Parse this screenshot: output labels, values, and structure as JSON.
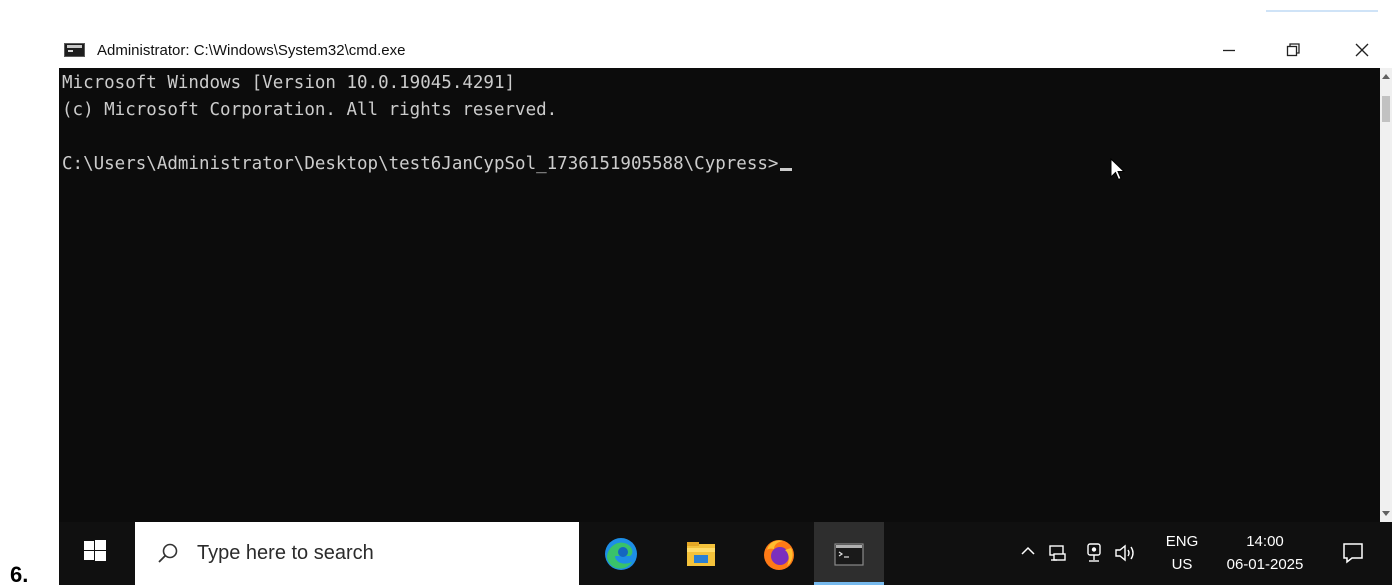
{
  "step_label": "6.",
  "window": {
    "title": "Administrator: C:\\Windows\\System32\\cmd.exe",
    "controls": {
      "minimize_icon": "minimize-icon",
      "maximize_icon": "restore-icon",
      "close_icon": "close-icon"
    }
  },
  "console": {
    "lines": [
      "Microsoft Windows [Version 10.0.19045.4291]",
      "(c) Microsoft Corporation. All rights reserved.",
      "",
      "C:\\Users\\Administrator\\Desktop\\test6JanCypSol_1736151905588\\Cypress>"
    ],
    "background": "#0c0c0c",
    "foreground": "#cccccc"
  },
  "taskbar": {
    "search_placeholder": "Type here to search",
    "apps": [
      "edge-icon",
      "file-explorer-icon",
      "firefox-icon",
      "command-prompt-icon"
    ],
    "active_app": "command-prompt-icon",
    "tray": {
      "language_top": "ENG",
      "language_bottom": "US",
      "time": "14:00",
      "date": "06-01-2025"
    },
    "accent": "#76b9ed"
  }
}
